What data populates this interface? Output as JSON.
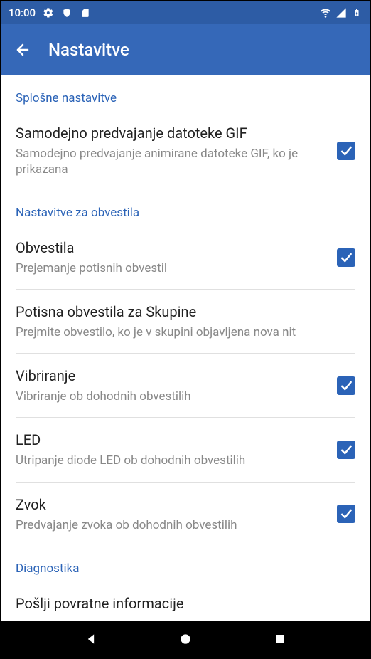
{
  "statusbar": {
    "time": "10:00"
  },
  "appbar": {
    "title": "Nastavitve"
  },
  "sections": {
    "general": {
      "header": "Splošne nastavitve",
      "gif": {
        "title": "Samodejno predvajanje datoteke GIF",
        "subtitle": "Samodejno predvajanje animirane datoteke GIF, ko je prikazana",
        "checked": true
      }
    },
    "notifications": {
      "header": "Nastavitve za obvestila",
      "notifications": {
        "title": "Obvestila",
        "subtitle": "Prejemanje potisnih obvestil",
        "checked": true
      },
      "groupPush": {
        "title": "Potisna obvestila za Skupine",
        "subtitle": "Prejmite obvestilo, ko je v skupini objavljena nova nit",
        "checked": false
      },
      "vibrate": {
        "title": "Vibriranje",
        "subtitle": "Vibriranje ob dohodnih obvestilih",
        "checked": true
      },
      "led": {
        "title": "LED",
        "subtitle": "Utripanje diode LED ob dohodnih obvestilih",
        "checked": true
      },
      "sound": {
        "title": "Zvok",
        "subtitle": "Predvajanje zvoka ob dohodnih obvestilih",
        "checked": true
      }
    },
    "diagnostics": {
      "header": "Diagnostika",
      "feedback": {
        "title": "Pošlji povratne informacije"
      }
    }
  }
}
